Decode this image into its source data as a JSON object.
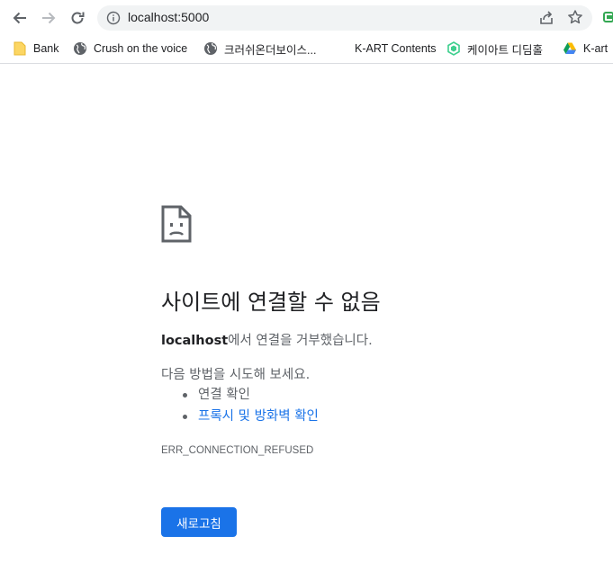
{
  "toolbar": {
    "back_icon": "arrow-left-icon",
    "forward_icon": "arrow-right-icon",
    "reload_icon": "reload-icon",
    "url": "localhost:5000",
    "share_icon": "share-icon",
    "star_icon": "star-icon"
  },
  "bookmarks": [
    {
      "label": "Bank",
      "icon": "folder-icon"
    },
    {
      "label": "Crush on the voice",
      "icon": "globe-icon"
    },
    {
      "label": "크러쉬온더보이스...",
      "icon": "globe-icon"
    },
    {
      "label": "K-ART Contents",
      "icon": ""
    },
    {
      "label": "케이아트 디딤홀",
      "icon": "hexagon-icon"
    },
    {
      "label": "K-art",
      "icon": "drive-icon"
    }
  ],
  "error": {
    "icon": "sad-document-icon",
    "title": "사이트에 연결할 수 없음",
    "host": "localhost",
    "message": "에서 연결을 거부했습니다.",
    "try_label": "다음 방법을 시도해 보세요.",
    "suggestions": [
      {
        "label": "연결 확인",
        "link": false
      },
      {
        "label": "프록시 및 방화벽 확인",
        "link": true
      }
    ],
    "code": "ERR_CONNECTION_REFUSED",
    "reload_label": "새로고침"
  },
  "colors": {
    "accent": "#1a73e8",
    "text_primary": "#202124",
    "text_secondary": "#5f6368",
    "omnibox_bg": "#f1f3f4"
  }
}
